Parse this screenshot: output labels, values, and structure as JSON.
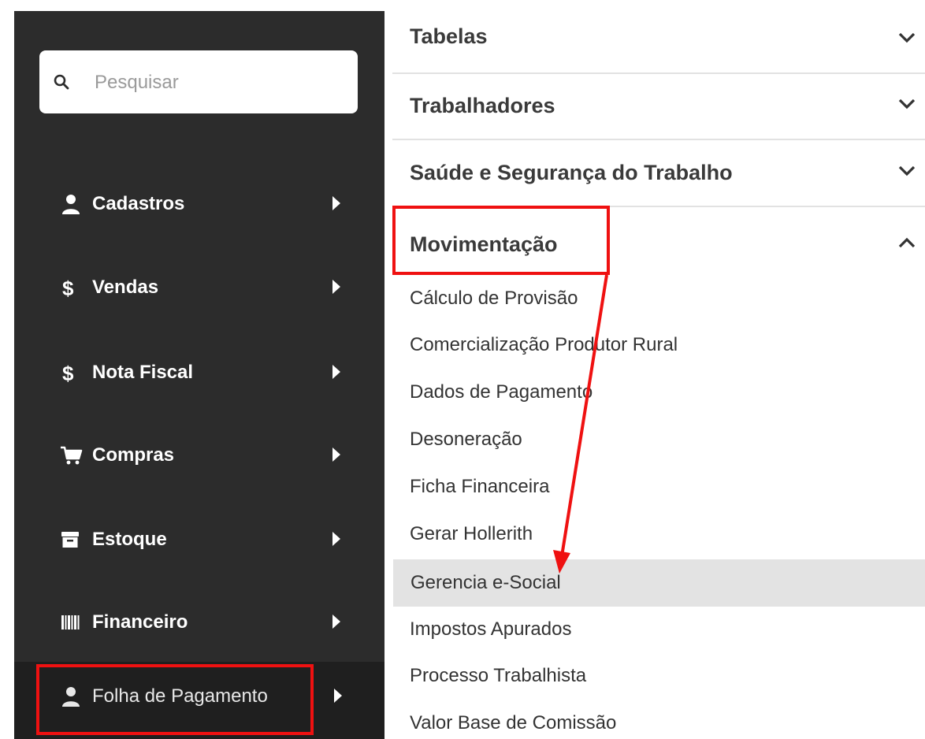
{
  "search": {
    "placeholder": "Pesquisar",
    "icon": "search-icon"
  },
  "sidebar": {
    "items": [
      {
        "label": "Cadastros",
        "icon": "user-icon"
      },
      {
        "label": "Vendas",
        "icon": "dollar-icon"
      },
      {
        "label": "Nota Fiscal",
        "icon": "dollar-icon"
      },
      {
        "label": "Compras",
        "icon": "cart-icon"
      },
      {
        "label": "Estoque",
        "icon": "archive-icon"
      },
      {
        "label": "Financeiro",
        "icon": "barcode-icon"
      },
      {
        "label": "Folha de Pagamento",
        "icon": "user-icon",
        "active": true
      }
    ]
  },
  "menu": {
    "sections": [
      {
        "label": "Tabelas",
        "expanded": false
      },
      {
        "label": "Trabalhadores",
        "expanded": false
      },
      {
        "label": "Saúde e Segurança do Trabalho",
        "expanded": false
      },
      {
        "label": "Movimentação",
        "expanded": true
      }
    ],
    "items": [
      {
        "label": "Cálculo de Provisão"
      },
      {
        "label": "Comercialização Produtor Rural"
      },
      {
        "label": "Dados de Pagamento"
      },
      {
        "label": "Desoneração"
      },
      {
        "label": "Ficha Financeira"
      },
      {
        "label": "Gerar Hollerith"
      },
      {
        "label": "Gerencia e-Social",
        "hovered": true
      },
      {
        "label": "Impostos Apurados"
      },
      {
        "label": "Processo Trabalhista"
      },
      {
        "label": "Valor Base de Comissão"
      }
    ]
  },
  "colors": {
    "sidebar_bg": "#2c2c2c",
    "highlight": "#ef1111",
    "hover_bg": "#e3e3e3"
  }
}
